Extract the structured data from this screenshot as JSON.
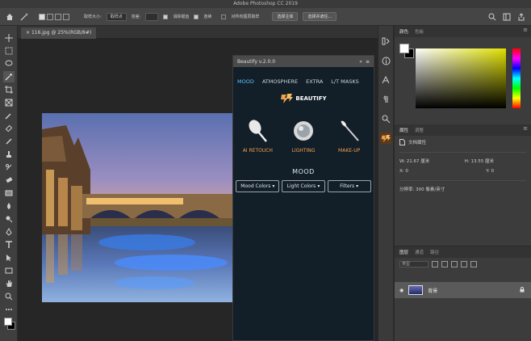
{
  "app": {
    "title": "Adobe Photoshop CC 2019"
  },
  "options_bar": {
    "sample_size_label": "取样大小:",
    "sample_size_value": "取样点",
    "tolerance_label": "容差:",
    "anti_alias_label": "消除锯齿",
    "contiguous_label": "连续",
    "all_layers_label": "对所有图层取样",
    "select_subject_button": "选择主体",
    "select_and_mask_button": "选择并遮住..."
  },
  "document": {
    "tab_title": "116.jpg @ 25%(RGB/8#)"
  },
  "beautify": {
    "title": "Beautify v.2.0.0",
    "nav": [
      "MOOD",
      "ATMOSPHERE",
      "EXTRA",
      "L/T MASKS"
    ],
    "nav_active": "MOOD",
    "logo_text": "BEAUTIFY",
    "tools": [
      {
        "label": "AI RETOUCH",
        "icon": "brush-icon"
      },
      {
        "label": "LIGHTING",
        "icon": "compact-mirror-icon"
      },
      {
        "label": "MAKE-UP",
        "icon": "makeup-brush-icon"
      }
    ],
    "section_title": "MOOD",
    "dropdowns": [
      "Mood Colors",
      "Light Colors",
      "Filters"
    ],
    "colors": {
      "accent": "#5ec8ff",
      "label": "#f0a04a",
      "bg": "#121e28"
    }
  },
  "color_panel": {
    "tabs": [
      "颜色",
      "色板"
    ]
  },
  "properties_panel": {
    "tabs": [
      "属性",
      "调整"
    ],
    "section": "文档属性",
    "w_label": "W: 21.67 厘米",
    "h_label": "H: 13.55 厘米",
    "x_label": "X: 0",
    "y_label": "Y: 0",
    "resolution": "分辨率: 300 像素/英寸"
  },
  "layers_panel": {
    "tabs": [
      "图层",
      "通道",
      "路径"
    ],
    "kind_label": "类型",
    "layer_name": "背景"
  }
}
